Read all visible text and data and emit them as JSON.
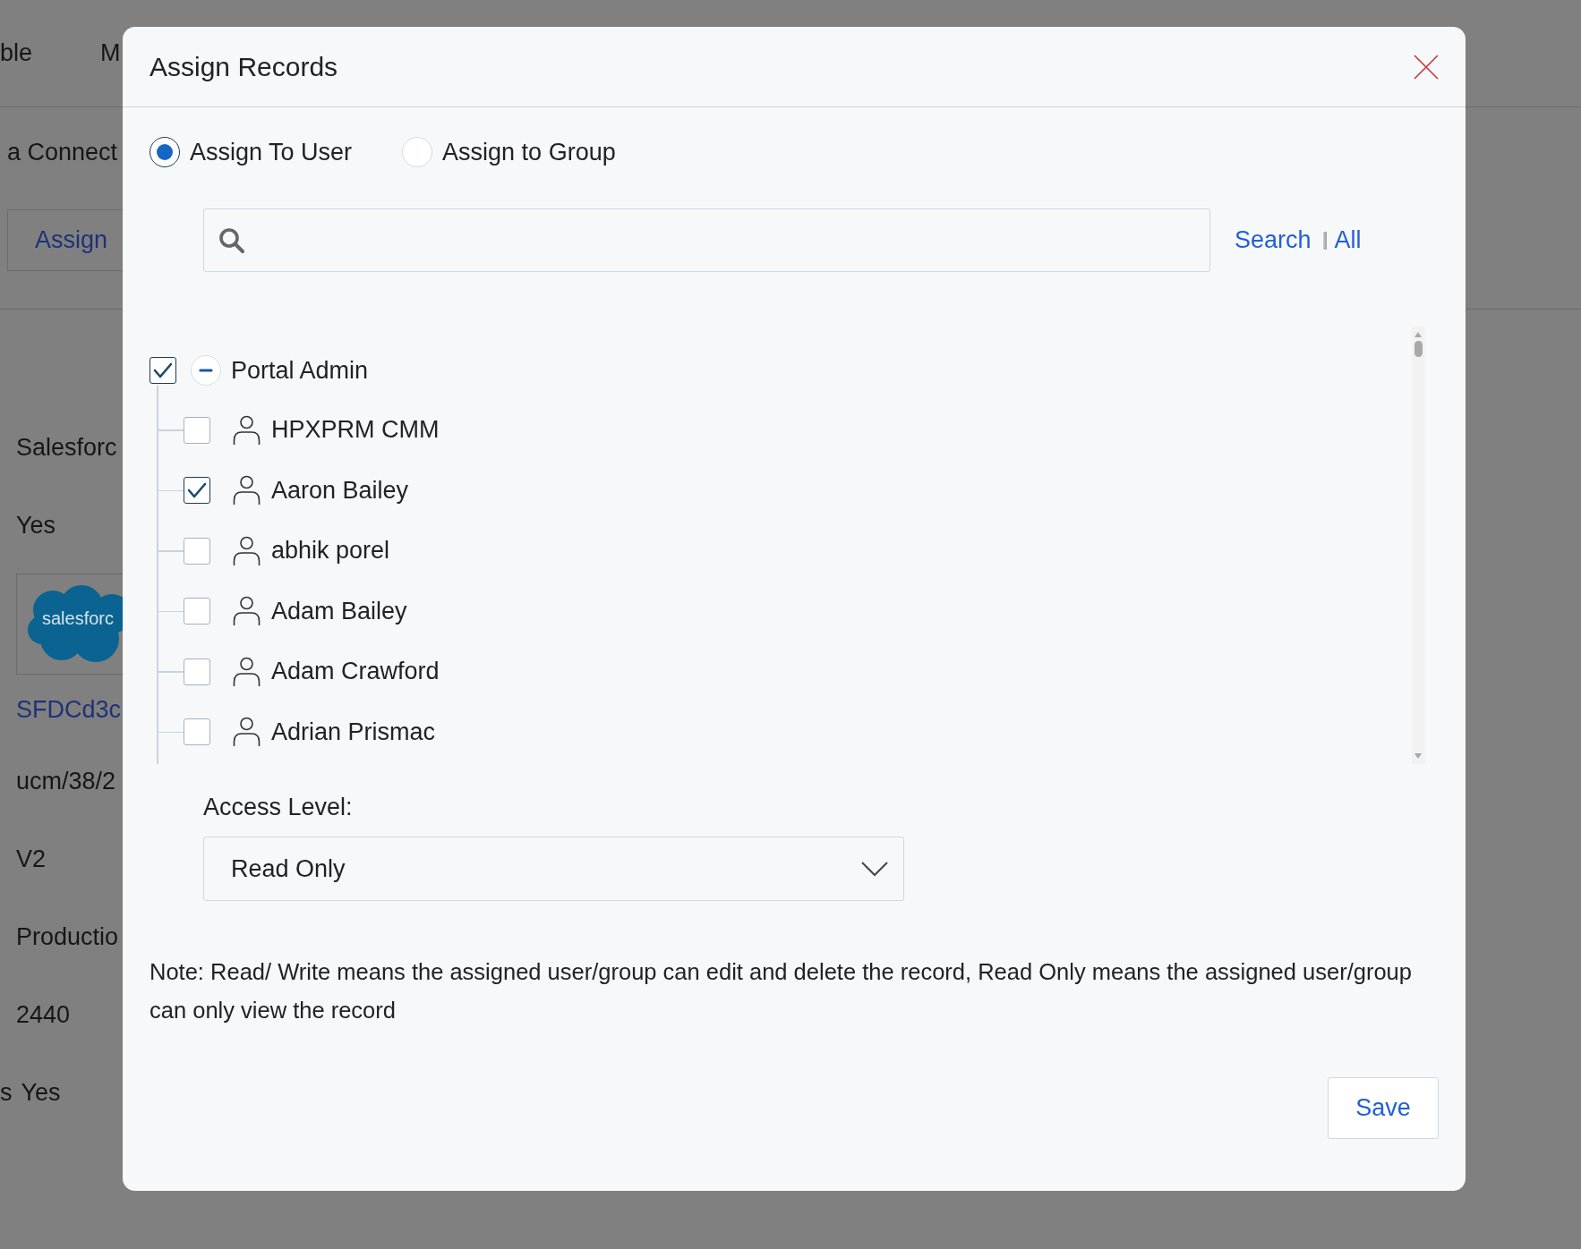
{
  "background": {
    "nav_items": [
      "ble",
      "M"
    ],
    "subtitle": "a Connect",
    "tab": "Assign",
    "fields": [
      {
        "kind": "text",
        "text": "Salesforc"
      },
      {
        "kind": "text",
        "text": "Yes"
      },
      {
        "kind": "logo",
        "text": "salesforc"
      },
      {
        "kind": "link",
        "text": "SFDCd3c"
      },
      {
        "kind": "text",
        "text": "ucm/38/2"
      },
      {
        "kind": "text",
        "text": "V2"
      },
      {
        "kind": "text",
        "text": "Productio"
      },
      {
        "kind": "text",
        "text": "2440"
      },
      {
        "kind": "pair",
        "label": "s",
        "text": "Yes"
      }
    ]
  },
  "dialog": {
    "title": "Assign Records",
    "assign_options": [
      {
        "label": "Assign To User",
        "selected": true
      },
      {
        "label": "Assign to Group",
        "selected": false
      }
    ],
    "search_actions": [
      "Search",
      "All"
    ],
    "tree": {
      "label": "Portal Admin",
      "checked": true,
      "expanded": true,
      "children": [
        {
          "label": "HPXPRM CMM",
          "checked": false
        },
        {
          "label": "Aaron Bailey",
          "checked": true
        },
        {
          "label": "abhik porel",
          "checked": false
        },
        {
          "label": "Adam Bailey",
          "checked": false
        },
        {
          "label": "Adam Crawford",
          "checked": false
        },
        {
          "label": "Adrian Prismac",
          "checked": false
        }
      ]
    },
    "access_level": {
      "label": "Access Level:",
      "value": "Read Only"
    },
    "note": "Note: Read/ Write means the assigned user/group can edit and delete the record, Read Only means the assigned user/group can only view the record",
    "save": "Save"
  }
}
